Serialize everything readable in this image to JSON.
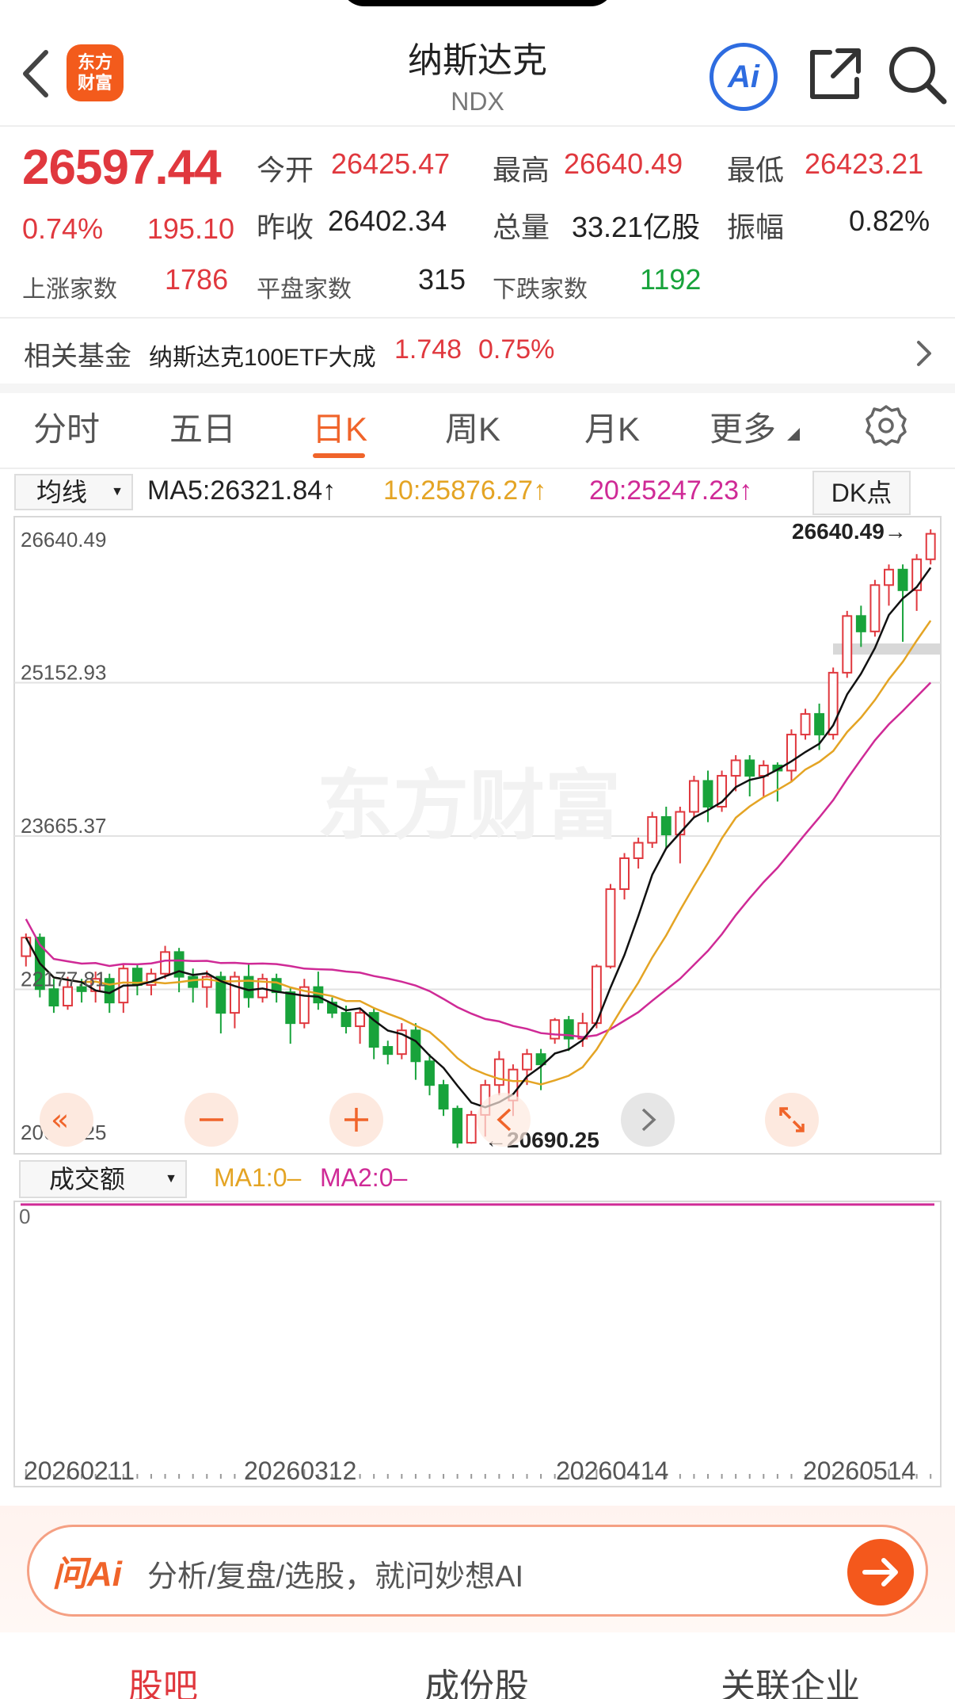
{
  "header": {
    "logo_line1": "东方",
    "logo_line2": "财富",
    "title": "纳斯达克",
    "subtitle": "NDX",
    "ai_label": "Ai"
  },
  "quote": {
    "price": "26597.44",
    "change_pct": "0.74%",
    "change": "195.10",
    "open_label": "今开",
    "open": "26425.47",
    "high_label": "最高",
    "high": "26640.49",
    "low_label": "最低",
    "low": "26423.21",
    "prev_close_label": "昨收",
    "prev_close": "26402.34",
    "volume_label": "总量",
    "volume": "33.21亿股",
    "amplitude_label": "振幅",
    "amplitude": "0.82%",
    "up_label": "上涨家数",
    "up_count": "1786",
    "flat_label": "平盘家数",
    "flat_count": "315",
    "down_label": "下跌家数",
    "down_count": "1192"
  },
  "fund": {
    "label": "相关基金",
    "name": "纳斯达克100ETF大成",
    "price": "1.748",
    "pct": "0.75%"
  },
  "tabs": [
    {
      "label": "分时"
    },
    {
      "label": "五日"
    },
    {
      "label": "日K"
    },
    {
      "label": "周K"
    },
    {
      "label": "月K"
    },
    {
      "label": "更多"
    }
  ],
  "indicators": {
    "select_label": "均线",
    "ma5": "MA5:26321.84↑",
    "ma10": "10:25876.27↑",
    "ma20": "20:25247.23↑",
    "dk_label": "DK点"
  },
  "chart_axis": {
    "y_labels": [
      "26640.49",
      "25152.93",
      "23665.37",
      "22177.81",
      "20690.25"
    ],
    "high_marker": "26640.49→",
    "low_marker": "←20690.25",
    "watermark": "东方财富"
  },
  "volume": {
    "select_label": "成交额",
    "ma1": "MA1:0–",
    "ma2": "MA2:0–",
    "zero": "0"
  },
  "dates": [
    "20260211",
    "20260312",
    "20260414",
    "20260514"
  ],
  "ai_bar": {
    "logo": "问Ai",
    "placeholder": "分析/复盘/选股，就问妙想AI"
  },
  "bottom_tabs": [
    {
      "label": "股吧"
    },
    {
      "label": "成份股"
    },
    {
      "label": "关联企业"
    }
  ],
  "colors": {
    "rise": "#e0383e",
    "fall": "#18a33b",
    "ma5": "#111111",
    "ma10": "#e4a424",
    "ma20": "#cf2a96",
    "accent": "#f0642a"
  },
  "chart_data": {
    "type": "candlestick",
    "ylim": [
      20690.25,
      26640.49
    ],
    "candles": [
      [
        22500,
        22680,
        22400,
        22720
      ],
      [
        22680,
        22180,
        22100,
        22720
      ],
      [
        22180,
        22020,
        21950,
        22280
      ],
      [
        22020,
        22200,
        21980,
        22300
      ],
      [
        22200,
        22160,
        22050,
        22280
      ],
      [
        22160,
        22280,
        22050,
        22350
      ],
      [
        22280,
        22050,
        21950,
        22330
      ],
      [
        22050,
        22380,
        21950,
        22420
      ],
      [
        22380,
        22220,
        22120,
        22420
      ],
      [
        22220,
        22330,
        22120,
        22380
      ],
      [
        22330,
        22540,
        22280,
        22600
      ],
      [
        22540,
        22300,
        22150,
        22580
      ],
      [
        22300,
        22200,
        22050,
        22380
      ],
      [
        22200,
        22300,
        22000,
        22360
      ],
      [
        22300,
        21950,
        21750,
        22350
      ],
      [
        21950,
        22300,
        21800,
        22350
      ],
      [
        22300,
        22100,
        22000,
        22420
      ],
      [
        22100,
        22280,
        22050,
        22330
      ],
      [
        22280,
        22150,
        22050,
        22330
      ],
      [
        22150,
        21850,
        21650,
        22200
      ],
      [
        21850,
        22200,
        21800,
        22280
      ],
      [
        22200,
        22050,
        21980,
        22350
      ],
      [
        22050,
        21950,
        21900,
        22100
      ],
      [
        21950,
        21820,
        21750,
        22020
      ],
      [
        21820,
        21950,
        21650,
        22000
      ],
      [
        21950,
        21620,
        21500,
        22000
      ],
      [
        21620,
        21550,
        21450,
        21680
      ],
      [
        21550,
        21780,
        21500,
        21850
      ],
      [
        21780,
        21480,
        21300,
        21850
      ],
      [
        21480,
        21250,
        21150,
        21550
      ],
      [
        21250,
        21020,
        20950,
        21300
      ],
      [
        21020,
        20690,
        20640,
        21050
      ],
      [
        20690,
        20960,
        20680,
        21000
      ],
      [
        20960,
        21250,
        20750,
        21300
      ],
      [
        21250,
        21500,
        21150,
        21580
      ],
      [
        21100,
        21400,
        20950,
        21450
      ],
      [
        21400,
        21550,
        21250,
        21600
      ],
      [
        21550,
        21450,
        21200,
        21600
      ],
      [
        21700,
        21880,
        21650,
        21900
      ],
      [
        21880,
        21700,
        21580,
        21920
      ],
      [
        21700,
        21850,
        21620,
        21950
      ],
      [
        21850,
        22400,
        21800,
        22420
      ],
      [
        22400,
        23150,
        22380,
        23200
      ],
      [
        23150,
        23450,
        23050,
        23500
      ],
      [
        23450,
        23600,
        23350,
        23650
      ],
      [
        23600,
        23850,
        23550,
        23900
      ],
      [
        23850,
        23680,
        23550,
        23950
      ],
      [
        23680,
        23900,
        23400,
        23950
      ],
      [
        23900,
        24200,
        23850,
        24250
      ],
      [
        24200,
        23950,
        23800,
        24300
      ],
      [
        23950,
        24250,
        23900,
        24300
      ],
      [
        24250,
        24400,
        24100,
        24450
      ],
      [
        24400,
        24250,
        24050,
        24450
      ],
      [
        24250,
        24350,
        24050,
        24400
      ],
      [
        24350,
        24300,
        24000,
        24380
      ],
      [
        24300,
        24650,
        24200,
        24700
      ],
      [
        24650,
        24850,
        24600,
        24900
      ],
      [
        24850,
        24650,
        24500,
        24950
      ],
      [
        24650,
        25250,
        24600,
        25300
      ],
      [
        25250,
        25800,
        25200,
        25850
      ],
      [
        25800,
        25650,
        25500,
        25900
      ],
      [
        25650,
        26100,
        25600,
        26150
      ],
      [
        26100,
        26250,
        25900,
        26300
      ],
      [
        26250,
        26050,
        25550,
        26300
      ],
      [
        26050,
        26350,
        25850,
        26400
      ],
      [
        26350,
        26597.44,
        26300,
        26640.49
      ]
    ],
    "ma5_last": 26321.84,
    "ma10_last": 25876.27,
    "ma20_last": 25247.23
  }
}
